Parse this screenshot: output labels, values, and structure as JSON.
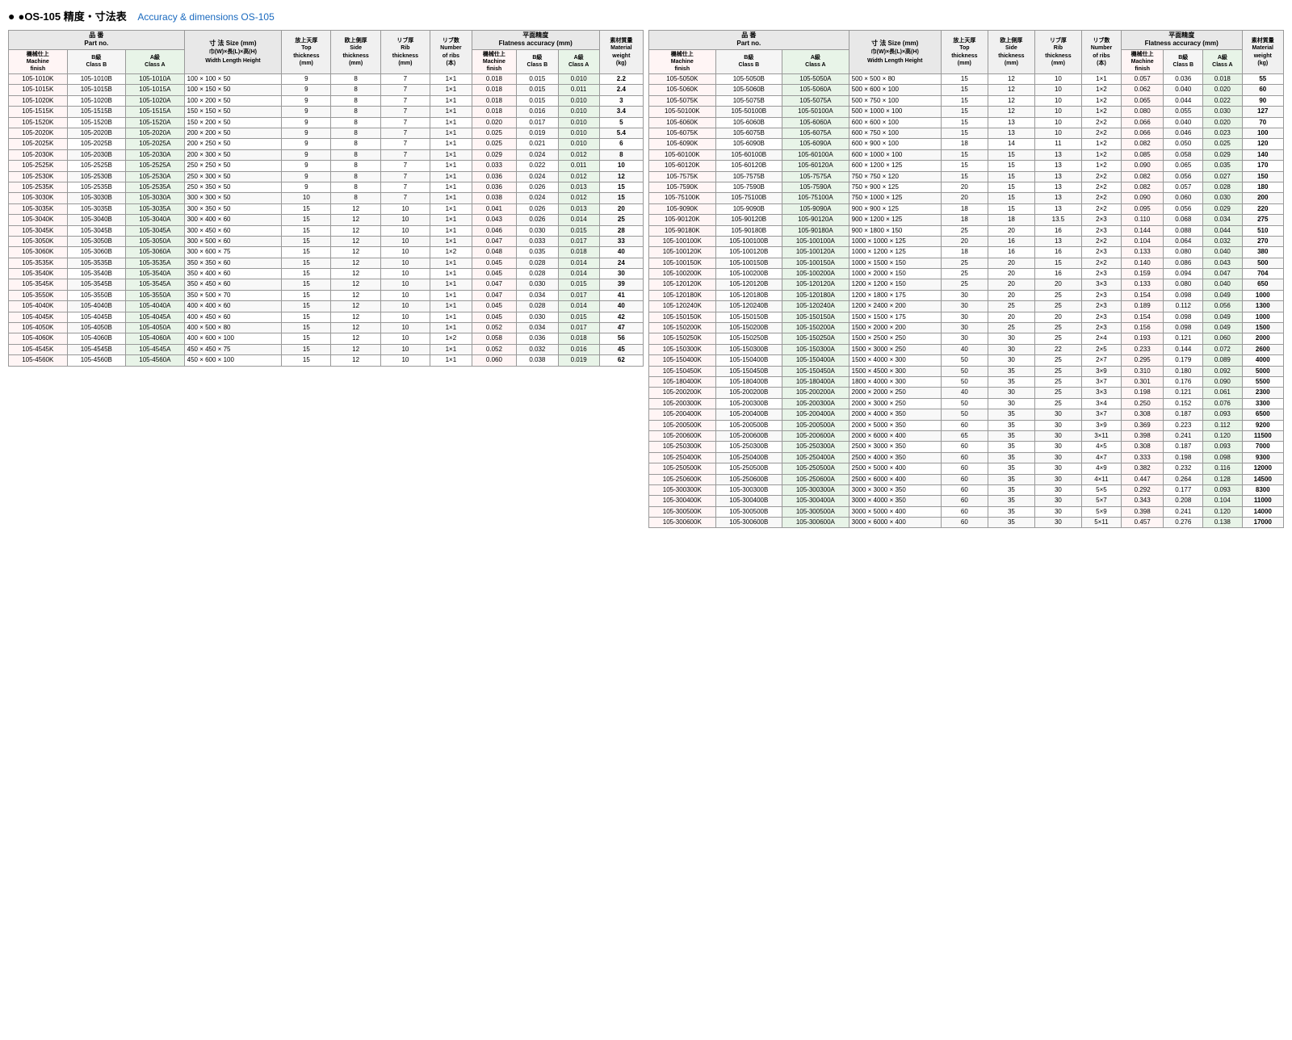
{
  "title": "●OS-105 精度・寸法表",
  "title_en": "Accuracy & dimensions OS-105",
  "headers": {
    "part_no": "品 番\nPart no.",
    "machine_finish": "機械仕上\nMachine\nfinish",
    "class_b": "B級\nClass B",
    "class_a": "A級\nClass A",
    "size": "寸 法  Size (mm)",
    "size_sub": "巾(W)×長(L)×高(H)\nWidth  Length  Height",
    "top_thickness": "放上天厚\nTop\nthickness\n(mm)",
    "side_thickness": "欧上側厚\nSide\nthickness\n(mm)",
    "rib_thickness": "リブ厚\nRib\nthickness\n(mm)",
    "num_ribs": "リブ数\nNumber\nof ribs\n(本)",
    "flatness": "平面精度\nFlatness accuracy (mm)",
    "flat_machine": "機械仕上\nMachine\nfinish",
    "flat_b": "B級\nClass B",
    "flat_a": "A級\nClass A",
    "material_weight": "素材質量\nMaterial\nweight\n(kg)"
  },
  "left_table": [
    [
      "105-1010K",
      "105-1010B",
      "105-1010A",
      "100 × 100 × 50",
      "9",
      "8",
      "7",
      "1×1",
      "0.018",
      "0.015",
      "0.010",
      "2.2"
    ],
    [
      "105-1015K",
      "105-1015B",
      "105-1015A",
      "100 × 150 × 50",
      "9",
      "8",
      "7",
      "1×1",
      "0.018",
      "0.015",
      "0.011",
      "2.4"
    ],
    [
      "105-1020K",
      "105-1020B",
      "105-1020A",
      "100 × 200 × 50",
      "9",
      "8",
      "7",
      "1×1",
      "0.018",
      "0.015",
      "0.010",
      "3"
    ],
    [
      "105-1515K",
      "105-1515B",
      "105-1515A",
      "150 × 150 × 50",
      "9",
      "8",
      "7",
      "1×1",
      "0.018",
      "0.016",
      "0.010",
      "3.4"
    ],
    [
      "105-1520K",
      "105-1520B",
      "105-1520A",
      "150 × 200 × 50",
      "9",
      "8",
      "7",
      "1×1",
      "0.020",
      "0.017",
      "0.010",
      "5"
    ],
    [
      "105-2020K",
      "105-2020B",
      "105-2020A",
      "200 × 200 × 50",
      "9",
      "8",
      "7",
      "1×1",
      "0.025",
      "0.019",
      "0.010",
      "5.4"
    ],
    [
      "105-2025K",
      "105-2025B",
      "105-2025A",
      "200 × 250 × 50",
      "9",
      "8",
      "7",
      "1×1",
      "0.025",
      "0.021",
      "0.010",
      "6"
    ],
    [
      "105-2030K",
      "105-2030B",
      "105-2030A",
      "200 × 300 × 50",
      "9",
      "8",
      "7",
      "1×1",
      "0.029",
      "0.024",
      "0.012",
      "8"
    ],
    [
      "105-2525K",
      "105-2525B",
      "105-2525A",
      "250 × 250 × 50",
      "9",
      "8",
      "7",
      "1×1",
      "0.033",
      "0.022",
      "0.011",
      "10"
    ],
    [
      "105-2530K",
      "105-2530B",
      "105-2530A",
      "250 × 300 × 50",
      "9",
      "8",
      "7",
      "1×1",
      "0.036",
      "0.024",
      "0.012",
      "12"
    ],
    [
      "105-2535K",
      "105-2535B",
      "105-2535A",
      "250 × 350 × 50",
      "9",
      "8",
      "7",
      "1×1",
      "0.036",
      "0.026",
      "0.013",
      "15"
    ],
    [
      "105-3030K",
      "105-3030B",
      "105-3030A",
      "300 × 300 × 50",
      "10",
      "8",
      "7",
      "1×1",
      "0.038",
      "0.024",
      "0.012",
      "15"
    ],
    [
      "105-3035K",
      "105-3035B",
      "105-3035A",
      "300 × 350 × 50",
      "15",
      "12",
      "10",
      "1×1",
      "0.041",
      "0.026",
      "0.013",
      "20"
    ],
    [
      "105-3040K",
      "105-3040B",
      "105-3040A",
      "300 × 400 × 60",
      "15",
      "12",
      "10",
      "1×1",
      "0.043",
      "0.026",
      "0.014",
      "25"
    ],
    [
      "105-3045K",
      "105-3045B",
      "105-3045A",
      "300 × 450 × 60",
      "15",
      "12",
      "10",
      "1×1",
      "0.046",
      "0.030",
      "0.015",
      "28"
    ],
    [
      "105-3050K",
      "105-3050B",
      "105-3050A",
      "300 × 500 × 60",
      "15",
      "12",
      "10",
      "1×1",
      "0.047",
      "0.033",
      "0.017",
      "33"
    ],
    [
      "105-3060K",
      "105-3060B",
      "105-3060A",
      "300 × 600 × 75",
      "15",
      "12",
      "10",
      "1×2",
      "0.048",
      "0.035",
      "0.018",
      "40"
    ],
    [
      "105-3535K",
      "105-3535B",
      "105-3535A",
      "350 × 350 × 60",
      "15",
      "12",
      "10",
      "1×1",
      "0.045",
      "0.028",
      "0.014",
      "24"
    ],
    [
      "105-3540K",
      "105-3540B",
      "105-3540A",
      "350 × 400 × 60",
      "15",
      "12",
      "10",
      "1×1",
      "0.045",
      "0.028",
      "0.014",
      "30"
    ],
    [
      "105-3545K",
      "105-3545B",
      "105-3545A",
      "350 × 450 × 60",
      "15",
      "12",
      "10",
      "1×1",
      "0.047",
      "0.030",
      "0.015",
      "39"
    ],
    [
      "105-3550K",
      "105-3550B",
      "105-3550A",
      "350 × 500 × 70",
      "15",
      "12",
      "10",
      "1×1",
      "0.047",
      "0.034",
      "0.017",
      "41"
    ],
    [
      "105-4040K",
      "105-4040B",
      "105-4040A",
      "400 × 400 × 60",
      "15",
      "12",
      "10",
      "1×1",
      "0.045",
      "0.028",
      "0.014",
      "40"
    ],
    [
      "105-4045K",
      "105-4045B",
      "105-4045A",
      "400 × 450 × 60",
      "15",
      "12",
      "10",
      "1×1",
      "0.045",
      "0.030",
      "0.015",
      "42"
    ],
    [
      "105-4050K",
      "105-4050B",
      "105-4050A",
      "400 × 500 × 80",
      "15",
      "12",
      "10",
      "1×1",
      "0.052",
      "0.034",
      "0.017",
      "47"
    ],
    [
      "105-4060K",
      "105-4060B",
      "105-4060A",
      "400 × 600 × 100",
      "15",
      "12",
      "10",
      "1×2",
      "0.058",
      "0.036",
      "0.018",
      "56"
    ],
    [
      "105-4545K",
      "105-4545B",
      "105-4545A",
      "450 × 450 × 75",
      "15",
      "12",
      "10",
      "1×1",
      "0.052",
      "0.032",
      "0.016",
      "45"
    ],
    [
      "105-4560K",
      "105-4560B",
      "105-4560A",
      "450 × 600 × 100",
      "15",
      "12",
      "10",
      "1×1",
      "0.060",
      "0.038",
      "0.019",
      "62"
    ]
  ],
  "right_table": [
    [
      "105-5050K",
      "105-5050B",
      "105-5050A",
      "500 × 500 × 80",
      "15",
      "12",
      "10",
      "1×1",
      "0.057",
      "0.036",
      "0.018",
      "55"
    ],
    [
      "105-5060K",
      "105-5060B",
      "105-5060A",
      "500 × 600 × 100",
      "15",
      "12",
      "10",
      "1×2",
      "0.062",
      "0.040",
      "0.020",
      "60"
    ],
    [
      "105-5075K",
      "105-5075B",
      "105-5075A",
      "500 × 750 × 100",
      "15",
      "12",
      "10",
      "1×2",
      "0.065",
      "0.044",
      "0.022",
      "90"
    ],
    [
      "105-50100K",
      "105-50100B",
      "105-50100A",
      "500 × 1000 × 100",
      "15",
      "12",
      "10",
      "1×2",
      "0.080",
      "0.055",
      "0.030",
      "127"
    ],
    [
      "105-6060K",
      "105-6060B",
      "105-6060A",
      "600 × 600 × 100",
      "15",
      "13",
      "10",
      "2×2",
      "0.066",
      "0.040",
      "0.020",
      "70"
    ],
    [
      "105-6075K",
      "105-6075B",
      "105-6075A",
      "600 × 750 × 100",
      "15",
      "13",
      "10",
      "2×2",
      "0.066",
      "0.046",
      "0.023",
      "100"
    ],
    [
      "105-6090K",
      "105-6090B",
      "105-6090A",
      "600 × 900 × 100",
      "18",
      "14",
      "11",
      "1×2",
      "0.082",
      "0.050",
      "0.025",
      "120"
    ],
    [
      "105-60100K",
      "105-60100B",
      "105-60100A",
      "600 × 1000 × 100",
      "15",
      "15",
      "13",
      "1×2",
      "0.085",
      "0.058",
      "0.029",
      "140"
    ],
    [
      "105-60120K",
      "105-60120B",
      "105-60120A",
      "600 × 1200 × 125",
      "15",
      "15",
      "13",
      "1×2",
      "0.090",
      "0.065",
      "0.035",
      "170"
    ],
    [
      "105-7575K",
      "105-7575B",
      "105-7575A",
      "750 × 750 × 120",
      "15",
      "15",
      "13",
      "2×2",
      "0.082",
      "0.056",
      "0.027",
      "150"
    ],
    [
      "105-7590K",
      "105-7590B",
      "105-7590A",
      "750 × 900 × 125",
      "20",
      "15",
      "13",
      "2×2",
      "0.082",
      "0.057",
      "0.028",
      "180"
    ],
    [
      "105-75100K",
      "105-75100B",
      "105-75100A",
      "750 × 1000 × 125",
      "20",
      "15",
      "13",
      "2×2",
      "0.090",
      "0.060",
      "0.030",
      "200"
    ],
    [
      "105-9090K",
      "105-9090B",
      "105-9090A",
      "900 × 900 × 125",
      "18",
      "15",
      "13",
      "2×2",
      "0.095",
      "0.056",
      "0.029",
      "220"
    ],
    [
      "105-90120K",
      "105-90120B",
      "105-90120A",
      "900 × 1200 × 125",
      "18",
      "18",
      "13.5",
      "2×3",
      "0.110",
      "0.068",
      "0.034",
      "275"
    ],
    [
      "105-90180K",
      "105-90180B",
      "105-90180A",
      "900 × 1800 × 150",
      "25",
      "20",
      "16",
      "2×3",
      "0.144",
      "0.088",
      "0.044",
      "510"
    ],
    [
      "105-100100K",
      "105-100100B",
      "105-100100A",
      "1000 × 1000 × 125",
      "20",
      "16",
      "13",
      "2×2",
      "0.104",
      "0.064",
      "0.032",
      "270"
    ],
    [
      "105-100120K",
      "105-100120B",
      "105-100120A",
      "1000 × 1200 × 125",
      "18",
      "16",
      "16",
      "2×3",
      "0.133",
      "0.080",
      "0.040",
      "380"
    ],
    [
      "105-100150K",
      "105-100150B",
      "105-100150A",
      "1000 × 1500 × 150",
      "25",
      "20",
      "15",
      "2×2",
      "0.140",
      "0.086",
      "0.043",
      "500"
    ],
    [
      "105-100200K",
      "105-100200B",
      "105-100200A",
      "1000 × 2000 × 150",
      "25",
      "20",
      "16",
      "2×3",
      "0.159",
      "0.094",
      "0.047",
      "704"
    ],
    [
      "105-120120K",
      "105-120120B",
      "105-120120A",
      "1200 × 1200 × 150",
      "25",
      "20",
      "20",
      "3×3",
      "0.133",
      "0.080",
      "0.040",
      "650"
    ],
    [
      "105-120180K",
      "105-120180B",
      "105-120180A",
      "1200 × 1800 × 175",
      "30",
      "20",
      "25",
      "2×3",
      "0.154",
      "0.098",
      "0.049",
      "1000"
    ],
    [
      "105-120240K",
      "105-120240B",
      "105-120240A",
      "1200 × 2400 × 200",
      "30",
      "25",
      "25",
      "2×3",
      "0.189",
      "0.112",
      "0.056",
      "1300"
    ],
    [
      "105-150150K",
      "105-150150B",
      "105-150150A",
      "1500 × 1500 × 175",
      "30",
      "20",
      "20",
      "2×3",
      "0.154",
      "0.098",
      "0.049",
      "1000"
    ],
    [
      "105-150200K",
      "105-150200B",
      "105-150200A",
      "1500 × 2000 × 200",
      "30",
      "25",
      "25",
      "2×3",
      "0.156",
      "0.098",
      "0.049",
      "1500"
    ],
    [
      "105-150250K",
      "105-150250B",
      "105-150250A",
      "1500 × 2500 × 250",
      "30",
      "30",
      "25",
      "2×4",
      "0.193",
      "0.121",
      "0.060",
      "2000"
    ],
    [
      "105-150300K",
      "105-150300B",
      "105-150300A",
      "1500 × 3000 × 250",
      "40",
      "30",
      "22",
      "2×5",
      "0.233",
      "0.144",
      "0.072",
      "2600"
    ],
    [
      "105-150400K",
      "105-150400B",
      "105-150400A",
      "1500 × 4000 × 300",
      "50",
      "30",
      "25",
      "2×7",
      "0.295",
      "0.179",
      "0.089",
      "4000"
    ],
    [
      "105-150450K",
      "105-150450B",
      "105-150450A",
      "1500 × 4500 × 300",
      "50",
      "35",
      "25",
      "3×9",
      "0.310",
      "0.180",
      "0.092",
      "5000"
    ],
    [
      "105-180400K",
      "105-180400B",
      "105-180400A",
      "1800 × 4000 × 300",
      "50",
      "35",
      "25",
      "3×7",
      "0.301",
      "0.176",
      "0.090",
      "5500"
    ],
    [
      "105-200200K",
      "105-200200B",
      "105-200200A",
      "2000 × 2000 × 250",
      "40",
      "30",
      "25",
      "3×3",
      "0.198",
      "0.121",
      "0.061",
      "2300"
    ],
    [
      "105-200300K",
      "105-200300B",
      "105-200300A",
      "2000 × 3000 × 250",
      "50",
      "30",
      "25",
      "3×4",
      "0.250",
      "0.152",
      "0.076",
      "3300"
    ],
    [
      "105-200400K",
      "105-200400B",
      "105-200400A",
      "2000 × 4000 × 350",
      "50",
      "35",
      "30",
      "3×7",
      "0.308",
      "0.187",
      "0.093",
      "6500"
    ],
    [
      "105-200500K",
      "105-200500B",
      "105-200500A",
      "2000 × 5000 × 350",
      "60",
      "35",
      "30",
      "3×9",
      "0.369",
      "0.223",
      "0.112",
      "9200"
    ],
    [
      "105-200600K",
      "105-200600B",
      "105-200600A",
      "2000 × 6000 × 400",
      "65",
      "35",
      "30",
      "3×11",
      "0.398",
      "0.241",
      "0.120",
      "11500"
    ],
    [
      "105-250300K",
      "105-250300B",
      "105-250300A",
      "2500 × 3000 × 350",
      "60",
      "35",
      "30",
      "4×5",
      "0.308",
      "0.187",
      "0.093",
      "7000"
    ],
    [
      "105-250400K",
      "105-250400B",
      "105-250400A",
      "2500 × 4000 × 350",
      "60",
      "35",
      "30",
      "4×7",
      "0.333",
      "0.198",
      "0.098",
      "9300"
    ],
    [
      "105-250500K",
      "105-250500B",
      "105-250500A",
      "2500 × 5000 × 400",
      "60",
      "35",
      "30",
      "4×9",
      "0.382",
      "0.232",
      "0.116",
      "12000"
    ],
    [
      "105-250600K",
      "105-250600B",
      "105-250600A",
      "2500 × 6000 × 400",
      "60",
      "35",
      "30",
      "4×11",
      "0.447",
      "0.264",
      "0.128",
      "14500"
    ],
    [
      "105-300300K",
      "105-300300B",
      "105-300300A",
      "3000 × 3000 × 350",
      "60",
      "35",
      "30",
      "5×5",
      "0.292",
      "0.177",
      "0.093",
      "8300"
    ],
    [
      "105-300400K",
      "105-300400B",
      "105-300400A",
      "3000 × 4000 × 350",
      "60",
      "35",
      "30",
      "5×7",
      "0.343",
      "0.208",
      "0.104",
      "11000"
    ],
    [
      "105-300500K",
      "105-300500B",
      "105-300500A",
      "3000 × 5000 × 400",
      "60",
      "35",
      "30",
      "5×9",
      "0.398",
      "0.241",
      "0.120",
      "14000"
    ],
    [
      "105-300600K",
      "105-300600B",
      "105-300600A",
      "3000 × 6000 × 400",
      "60",
      "35",
      "30",
      "5×11",
      "0.457",
      "0.276",
      "0.138",
      "17000"
    ]
  ]
}
